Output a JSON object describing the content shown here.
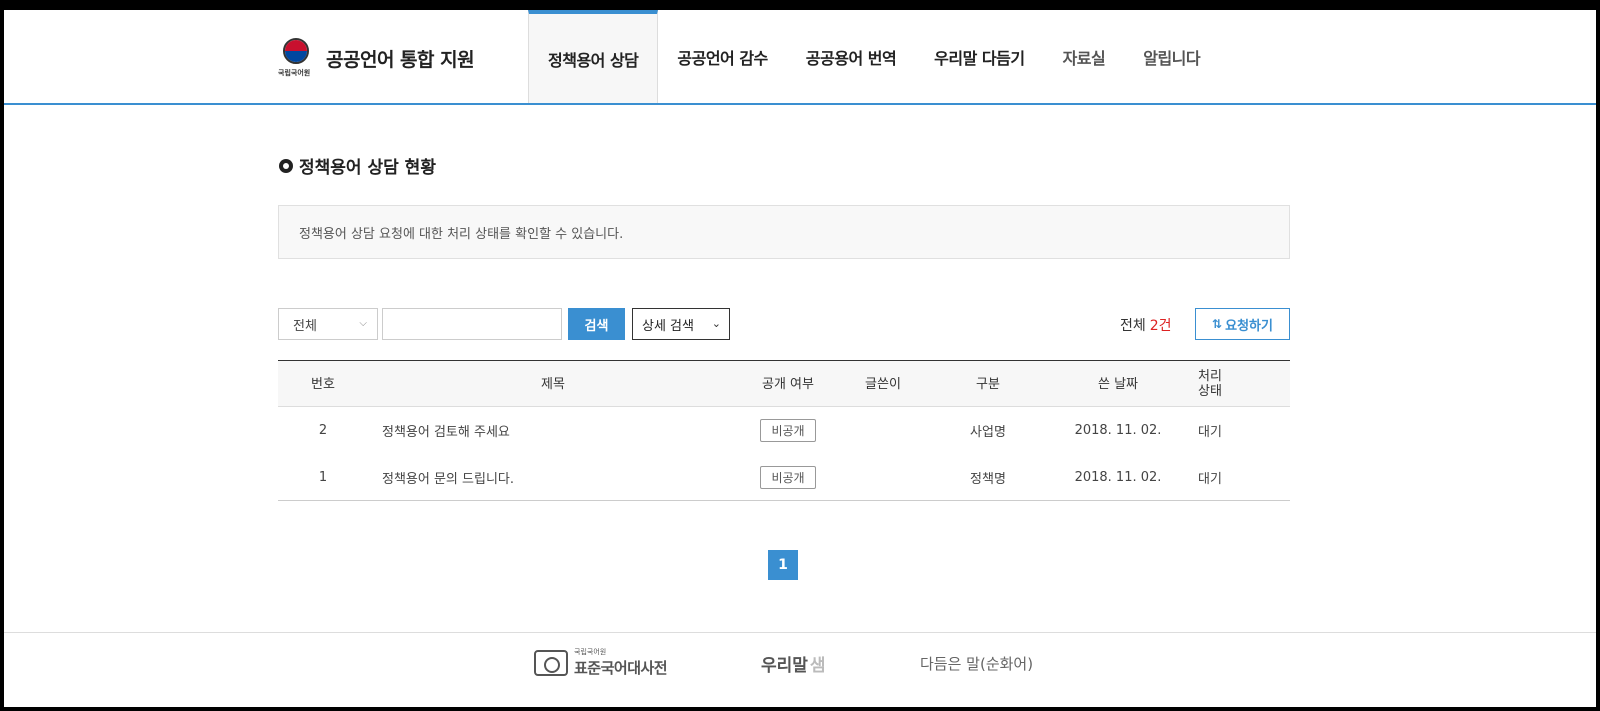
{
  "header": {
    "logo_sub": "국립국어원",
    "logo_title": "공공언어 통합 지원",
    "nav": [
      {
        "label": "정책용어 상담",
        "active": true
      },
      {
        "label": "공공언어 감수"
      },
      {
        "label": "공공용어 번역"
      },
      {
        "label": "우리말 다듬기"
      },
      {
        "label": "자료실",
        "muted": true
      },
      {
        "label": "알립니다",
        "muted": true
      }
    ]
  },
  "section": {
    "title": "정책용어 상담 현황",
    "notice": "정책용어 상담 요청에 대한 처리 상태를 확인할 수 있습니다."
  },
  "search": {
    "filter_value": "전체",
    "query": "",
    "search_label": "검색",
    "detail_label": "상세 검색",
    "total_label": "전체",
    "total_count": "2건",
    "request_label": "요청하기"
  },
  "table": {
    "headers": {
      "no": "번호",
      "title": "제목",
      "open": "공개 여부",
      "writer": "글쓴이",
      "type": "구분",
      "date": "쓴 날짜",
      "status": "처리\n상태"
    },
    "rows": [
      {
        "no": "2",
        "title": "정책용어 검토해 주세요",
        "open": "비공개",
        "writer": "",
        "type": "사업명",
        "date": "2018. 11. 02.",
        "status": "대기"
      },
      {
        "no": "1",
        "title": "정책용어 문의 드립니다.",
        "open": "비공개",
        "writer": "",
        "type": "정책명",
        "date": "2018. 11. 02.",
        "status": "대기"
      }
    ]
  },
  "pagination": {
    "current": "1"
  },
  "footer": {
    "logo1_small": "국립국어원",
    "logo1_big": "표준국어대사전",
    "logo2_main": "우리말",
    "logo2_light": "샘",
    "logo3": "다듬은 말(순화어)"
  }
}
